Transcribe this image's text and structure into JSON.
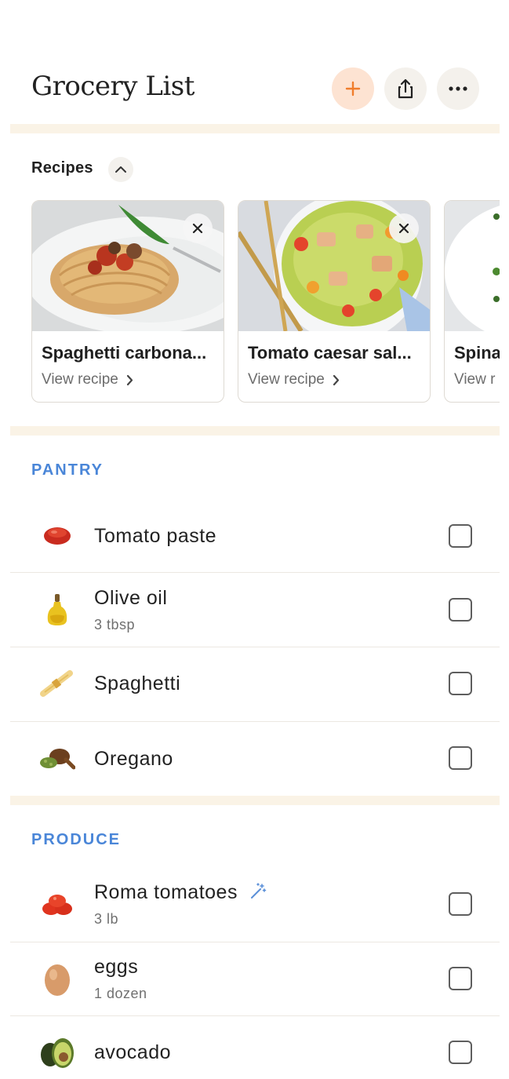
{
  "header": {
    "title": "Grocery List"
  },
  "recipes": {
    "label": "Recipes",
    "cards": [
      {
        "name": "Spaghetti carbona...",
        "view": "View recipe"
      },
      {
        "name": "Tomato caesar sal...",
        "view": "View recipe"
      },
      {
        "name": "Spina",
        "view": "View r"
      }
    ]
  },
  "sections": [
    {
      "title": "PANTRY",
      "items": [
        {
          "name": "Tomato paste",
          "qty": ""
        },
        {
          "name": "Olive oil",
          "qty": "3 tbsp"
        },
        {
          "name": "Spaghetti",
          "qty": ""
        },
        {
          "name": "Oregano",
          "qty": ""
        }
      ]
    },
    {
      "title": "PRODUCE",
      "items": [
        {
          "name": "Roma tomatoes",
          "qty": "3 lb"
        },
        {
          "name": "eggs",
          "qty": "1 dozen"
        },
        {
          "name": "avocado",
          "qty": ""
        }
      ]
    }
  ],
  "colors": {
    "accent": "#f07d2c",
    "section": "#4a86d8",
    "band": "#faf3e6"
  }
}
